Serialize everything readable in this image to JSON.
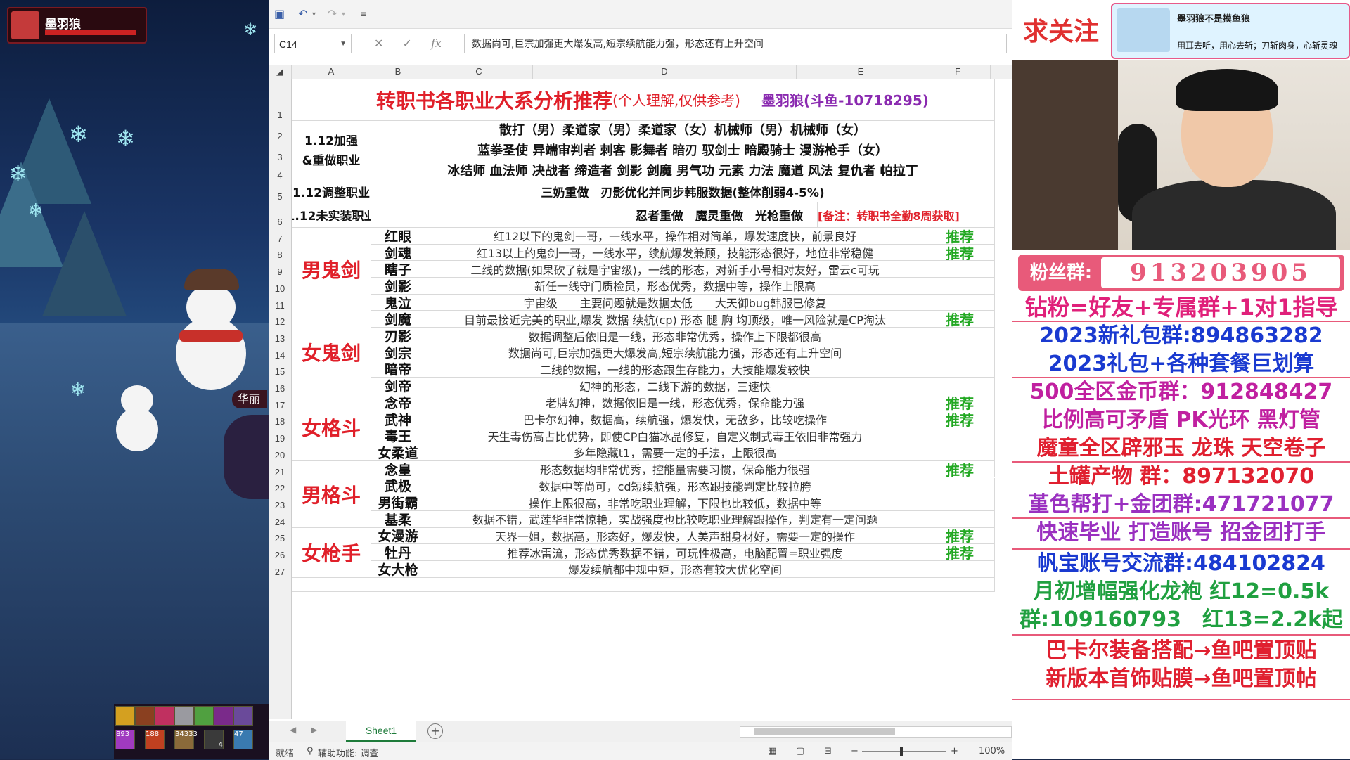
{
  "game": {
    "player_name": "墨羽狼",
    "side_text": "华丽",
    "skill_counts": [
      "893",
      "188",
      "34333",
      "2",
      "2",
      "3",
      "4",
      "47"
    ]
  },
  "excel": {
    "name_box": "C14",
    "formula_text": "数据尚可,巨宗加强更大爆发高,短宗续航能力强，形态还有上升空间",
    "columns": [
      "A",
      "B",
      "C",
      "D",
      "E",
      "F"
    ],
    "rows": [
      "1",
      "2",
      "3",
      "4",
      "5",
      "6",
      "7",
      "8",
      "9",
      "10",
      "11",
      "12",
      "13",
      "14",
      "15",
      "16",
      "17",
      "18",
      "19",
      "20",
      "21",
      "22",
      "23",
      "24",
      "25",
      "26",
      "27"
    ],
    "title": "转职书各职业大系分析推荐",
    "title_sub": "(个人理解,仅供参考)",
    "author": "墨羽狼(斗鱼-10718295)",
    "section1_label": "1.12加强&重做职业",
    "section1_lines": [
      "散打（男）柔道家（男）柔道家（女）机械师（男）机械师（女）",
      "蓝拳圣使 异端审判者 刺客 影舞者 暗刃 驭剑士 暗殿骑士 漫游枪手（女）",
      "冰结师 血法师 决战者 缔造者 剑影 剑魔 男气功 元素 力法 魔道 风法 复仇者 帕拉丁"
    ],
    "section2_label": "1.12调整职业",
    "section2_text": "三奶重做　刃影优化并同步韩服数据(整体削弱4-5%)",
    "section3_label": "1.12未实装职业",
    "section3_text": "忍者重做　魔灵重做　光枪重做",
    "section3_note": "[备注：转职书全勤8周获取]",
    "recommend": "推荐",
    "groups": [
      {
        "name": "男鬼剑",
        "jobs": [
          {
            "job": "红眼",
            "desc": "红12以下的鬼剑一哥，一线水平，操作相对简单，爆发速度快，前景良好",
            "rec": true
          },
          {
            "job": "剑魂",
            "desc": "红13以上的鬼剑一哥，一线水平，续航爆发兼顾，技能形态很好，地位非常稳健",
            "rec": true
          },
          {
            "job": "瞎子",
            "desc": "二线的数据(如果砍了就是宇宙级)，一线的形态，对新手小号相对友好，雷云c可玩",
            "rec": false
          },
          {
            "job": "剑影",
            "desc": "新任一线守门质检员，形态优秀，数据中等，操作上限高",
            "rec": false
          },
          {
            "job": "鬼泣",
            "desc": "宇宙级　　主要问题就是数据太低　　大天御bug韩服已修复",
            "rec": false
          }
        ]
      },
      {
        "name": "女鬼剑",
        "jobs": [
          {
            "job": "剑魔",
            "desc": "目前最接近完美的职业,爆发 数据 续航(cp) 形态 腿 胸 均顶级，唯一风险就是CP淘汰",
            "rec": true
          },
          {
            "job": "刃影",
            "desc": "数据调整后依旧是一线，形态非常优秀，操作上下限都很高",
            "rec": false
          },
          {
            "job": "剑宗",
            "desc": "数据尚可,巨宗加强更大爆发高,短宗续航能力强，形态还有上升空间",
            "rec": false
          },
          {
            "job": "暗帝",
            "desc": "二线的数据，一线的形态跟生存能力，大技能爆发较快",
            "rec": false
          },
          {
            "job": "剑帝",
            "desc": "幻神的形态，二线下游的数据，三速快",
            "rec": false
          }
        ]
      },
      {
        "name": "女格斗",
        "jobs": [
          {
            "job": "念帝",
            "desc": "老牌幻神，数据依旧是一线，形态优秀，保命能力强",
            "rec": true
          },
          {
            "job": "武神",
            "desc": "巴卡尔幻神，数据高，续航强，爆发快，无敌多，比较吃操作",
            "rec": true
          },
          {
            "job": "毒王",
            "desc": "天生毒伤高占比优势，即使CP白猫冰晶修复，自定义制式毒王依旧非常强力",
            "rec": false
          },
          {
            "job": "女柔道",
            "desc": "多年隐藏t1，需要一定的手法，上限很高",
            "rec": false
          }
        ]
      },
      {
        "name": "男格斗",
        "jobs": [
          {
            "job": "念皇",
            "desc": "形态数据均非常优秀，控能量需要习惯，保命能力很强",
            "rec": true
          },
          {
            "job": "武极",
            "desc": "数据中等尚可，cd短续航强，形态跟技能判定比较拉胯",
            "rec": false
          },
          {
            "job": "男街霸",
            "desc": "操作上限很高，非常吃职业理解，下限也比较低，数据中等",
            "rec": false
          },
          {
            "job": "基柔",
            "desc": "数据不错，武莲华非常惊艳，实战强度也比较吃职业理解跟操作，判定有一定问题",
            "rec": false
          }
        ]
      },
      {
        "name": "女枪手",
        "jobs": [
          {
            "job": "女漫游",
            "desc": "天界一姐，数据高，形态好，爆发快，人美声甜身材好，需要一定的操作",
            "rec": true
          },
          {
            "job": "牡丹",
            "desc": "推荐冰雷流，形态优秀数据不错，可玩性极高，电脑配置=职业强度",
            "rec": true
          },
          {
            "job": "女大枪",
            "desc": "爆发续航都中规中矩，形态有较大优化空间",
            "rec": false
          }
        ]
      }
    ],
    "sheet_tab": "Sheet1",
    "status_ready": "就绪",
    "status_access": "辅助功能: 调查",
    "zoom": "100%"
  },
  "stream": {
    "follow": "求关注",
    "banner_title": "墨羽狼不是摸鱼狼",
    "banner_slogan": "用耳去听，用心去斩；刀斩肉身，心斩灵魂",
    "fan_label": "粉丝群:",
    "fan_number": "913203905",
    "ads": [
      {
        "text": "钻粉=好友+专属群+1对1指导",
        "color": "#e0207a"
      },
      {
        "text": "2023新礼包群:894863282",
        "color": "#1a3ad0"
      },
      {
        "text": "2023礼包+各种套餐巨划算",
        "color": "#1a3ad0"
      },
      {
        "text": "500全区金币群：912848427",
        "color": "#c020a0"
      },
      {
        "text": "比例高可矛盾 PK光环 黑灯管",
        "color": "#c020a0"
      },
      {
        "text": "魔童全区辟邪玉 龙珠 天空卷子",
        "color": "#e02030"
      },
      {
        "text": "土罐产物 群：897132070",
        "color": "#e02030"
      },
      {
        "text": "堇色帮打+金团群:471721077",
        "color": "#9a30c0"
      },
      {
        "text": "快速毕业 打造账号 招金团打手",
        "color": "#9a30c0"
      },
      {
        "text": "帆宝账号交流群:484102824",
        "color": "#1a3ad0"
      },
      {
        "text": "月初增幅强化龙袍 红12=0.5k",
        "color": "#20a040"
      },
      {
        "text": "群:109160793　红13=2.2k起",
        "color": "#20a040"
      },
      {
        "text": "巴卡尔装备搭配→鱼吧置顶贴",
        "color": "#e02030"
      },
      {
        "text": "新版本首饰贴膜→鱼吧置顶帖",
        "color": "#e02030"
      }
    ]
  }
}
